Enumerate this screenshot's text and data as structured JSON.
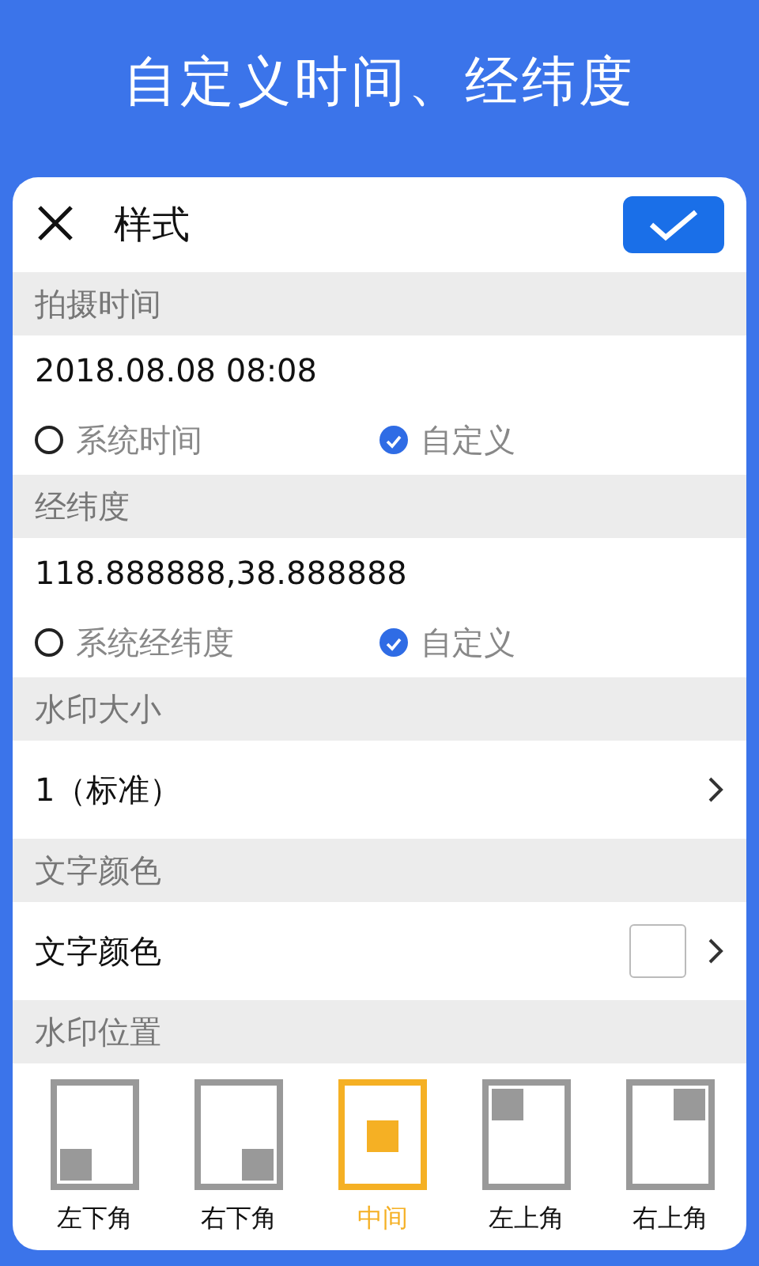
{
  "title": "自定义时间、经纬度",
  "dialog": {
    "title": "样式"
  },
  "sections": [
    {
      "kind": "radio",
      "label": "拍摄时间",
      "value": "2018.08.08 08:08",
      "options": [
        {
          "label": "系统时间",
          "selected": false
        },
        {
          "label": "自定义",
          "selected": true
        }
      ]
    },
    {
      "kind": "radio",
      "label": "经纬度",
      "value": "118.888888,38.888888",
      "options": [
        {
          "label": "系统经纬度",
          "selected": false
        },
        {
          "label": "自定义",
          "selected": true
        }
      ]
    },
    {
      "kind": "select",
      "label": "水印大小",
      "value": "1（标准）"
    },
    {
      "kind": "color",
      "label": "文字颜色",
      "value": "文字颜色",
      "color": "#ffffff"
    },
    {
      "kind": "position",
      "label": "水印位置",
      "options": [
        {
          "label": "左下角",
          "kind": "bottomleft",
          "selected": false
        },
        {
          "label": "右下角",
          "kind": "bottomright",
          "selected": false
        },
        {
          "label": "中间",
          "kind": "center",
          "selected": true
        },
        {
          "label": "左上角",
          "kind": "topleft",
          "selected": false
        },
        {
          "label": "右上角",
          "kind": "topright",
          "selected": false
        }
      ]
    }
  ]
}
